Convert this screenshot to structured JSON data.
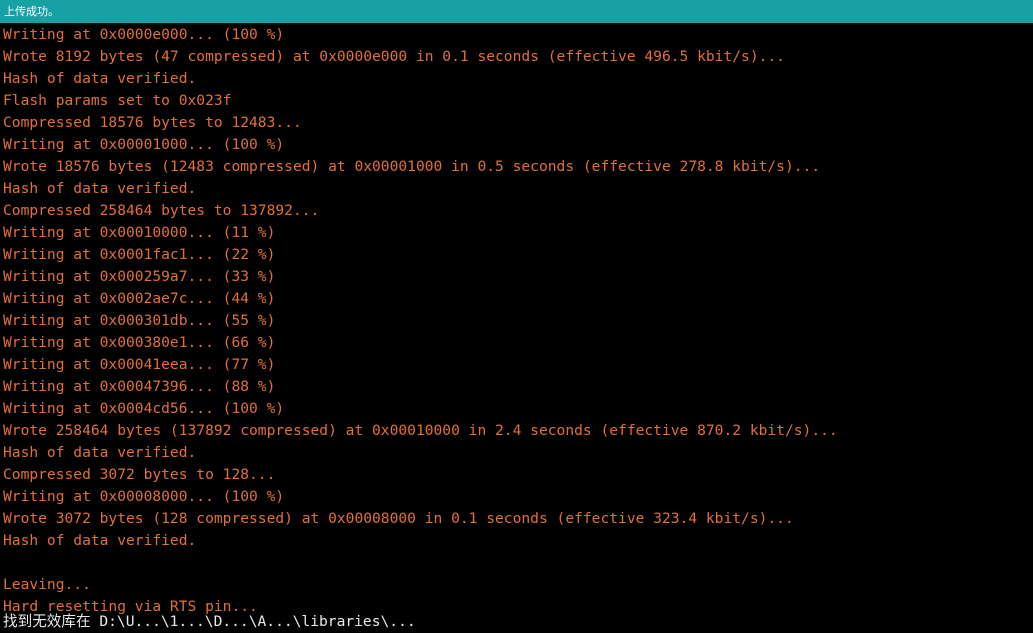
{
  "status_bar": {
    "message": "上传成功。",
    "background_color": "#17a1a5"
  },
  "console": {
    "text_color": "#e0703a",
    "background_color": "#000000",
    "lines": [
      "Writing at 0x0000e000... (100 %)",
      "Wrote 8192 bytes (47 compressed) at 0x0000e000 in 0.1 seconds (effective 496.5 kbit/s)...",
      "Hash of data verified.",
      "Flash params set to 0x023f",
      "Compressed 18576 bytes to 12483...",
      "Writing at 0x00001000... (100 %)",
      "Wrote 18576 bytes (12483 compressed) at 0x00001000 in 0.5 seconds (effective 278.8 kbit/s)...",
      "Hash of data verified.",
      "Compressed 258464 bytes to 137892...",
      "Writing at 0x00010000... (11 %)",
      "Writing at 0x0001fac1... (22 %)",
      "Writing at 0x000259a7... (33 %)",
      "Writing at 0x0002ae7c... (44 %)",
      "Writing at 0x000301db... (55 %)",
      "Writing at 0x000380e1... (66 %)",
      "Writing at 0x00041eea... (77 %)",
      "Writing at 0x00047396... (88 %)",
      "Writing at 0x0004cd56... (100 %)",
      "Wrote 258464 bytes (137892 compressed) at 0x00010000 in 2.4 seconds (effective 870.2 kbit/s)...",
      "Hash of data verified.",
      "Compressed 3072 bytes to 128...",
      "Writing at 0x00008000... (100 %)",
      "Wrote 3072 bytes (128 compressed) at 0x00008000 in 0.1 seconds (effective 323.4 kbit/s)...",
      "Hash of data verified.",
      "",
      "Leaving...",
      "Hard resetting via RTS pin..."
    ],
    "partial_line": "找到无效库在 D:\\U...\\1...\\D...\\A...\\libraries\\..."
  }
}
